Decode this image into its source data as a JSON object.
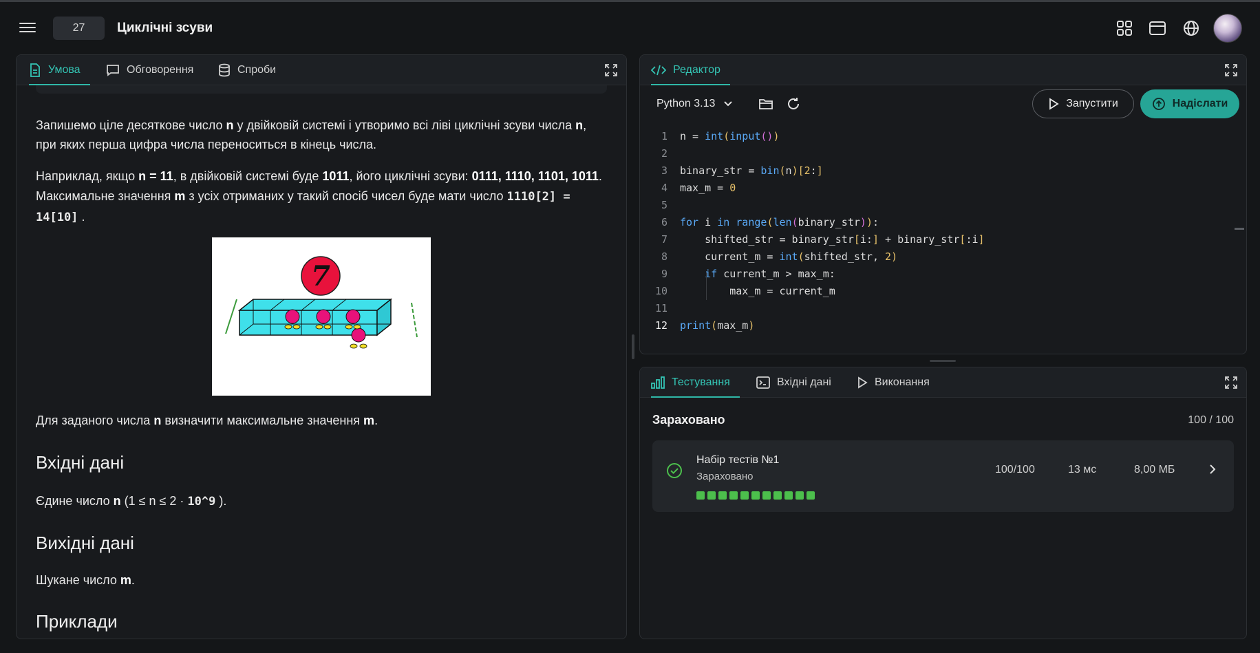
{
  "header": {
    "problem_number": "27",
    "problem_title": "Циклічні зсуви",
    "icons": [
      "apps-grid-icon",
      "browser-window-icon",
      "globe-icon",
      "user-avatar"
    ]
  },
  "left_panel": {
    "tabs": [
      {
        "label": "Умова",
        "icon": "document-icon",
        "active": true
      },
      {
        "label": "Обговорення",
        "icon": "chat-icon",
        "active": false
      },
      {
        "label": "Спроби",
        "icon": "database-icon",
        "active": false
      }
    ],
    "statement": {
      "p1_a": "Запишемо ціле десяткове число ",
      "p1_n1": "n",
      "p1_b": " у двійковій системі і утворимо всі ліві циклічні зсуви числа ",
      "p1_n2": "n",
      "p1_c": ", при яких перша цифра числа переноситься в кінець числа.",
      "p2_a": "Наприклад, якщо ",
      "p2_n": "n = 11",
      "p2_b": ", в двійковій системі буде ",
      "p2_bin": "1011",
      "p2_c": ", його циклічні зсуви: ",
      "p2_shifts": "0111, 1110, 1101, 1011",
      "p2_d": ". Максимальне значення ",
      "p2_m": "m",
      "p2_e": " з усіх отриманих у такий спосіб чисел буде мати число ",
      "p2_formula": "1110[2] = 14[10]",
      "p2_f": ".",
      "p3_a": "Для заданого числа ",
      "p3_n": "n",
      "p3_b": " визначити максимальне значення ",
      "p3_m": "m",
      "p3_c": ".",
      "input_heading": "Вхідні дані",
      "input_a": "Єдине число ",
      "input_n": "n",
      "input_b": " (1 ≤ n ≤ 2 · ",
      "input_pow": "10^9",
      "input_c": " ).",
      "output_heading": "Вихідні дані",
      "output_a": "Шукане число ",
      "output_m": "m",
      "output_b": ".",
      "examples_heading": "Приклади",
      "illustration_digit": "7"
    }
  },
  "editor": {
    "tab_label": "Редактор",
    "language": "Python 3.13",
    "run_label": "Запустити",
    "submit_label": "Надіслати",
    "line_numbers": [
      "1",
      "2",
      "3",
      "4",
      "5",
      "6",
      "7",
      "8",
      "9",
      "10",
      "11",
      "12"
    ],
    "lines": [
      "n = int(input())",
      "",
      "binary_str = bin(n)[2:]",
      "max_m = 0",
      "",
      "for i in range(len(binary_str)):",
      "    shifted_str = binary_str[i:] + binary_str[:i]",
      "    current_m = int(shifted_str, 2)",
      "    if current_m > max_m:",
      "        max_m = current_m",
      "",
      "print(max_m)"
    ]
  },
  "testing": {
    "tabs": [
      {
        "label": "Тестування",
        "icon": "bar-chart-icon",
        "active": true
      },
      {
        "label": "Вхідні дані",
        "icon": "terminal-icon",
        "active": false
      },
      {
        "label": "Виконання",
        "icon": "play-icon",
        "active": false
      }
    ],
    "result_title": "Зараховано",
    "result_score": "100 / 100",
    "test_set": {
      "name": "Набір тестів №1",
      "status": "Зараховано",
      "score": "100/100",
      "time": "13 мс",
      "memory": "8,00 МБ",
      "passed_count": 11
    }
  },
  "colors": {
    "accent": "#2fb8a8",
    "success": "#4cbf4c",
    "background": "#141618"
  }
}
